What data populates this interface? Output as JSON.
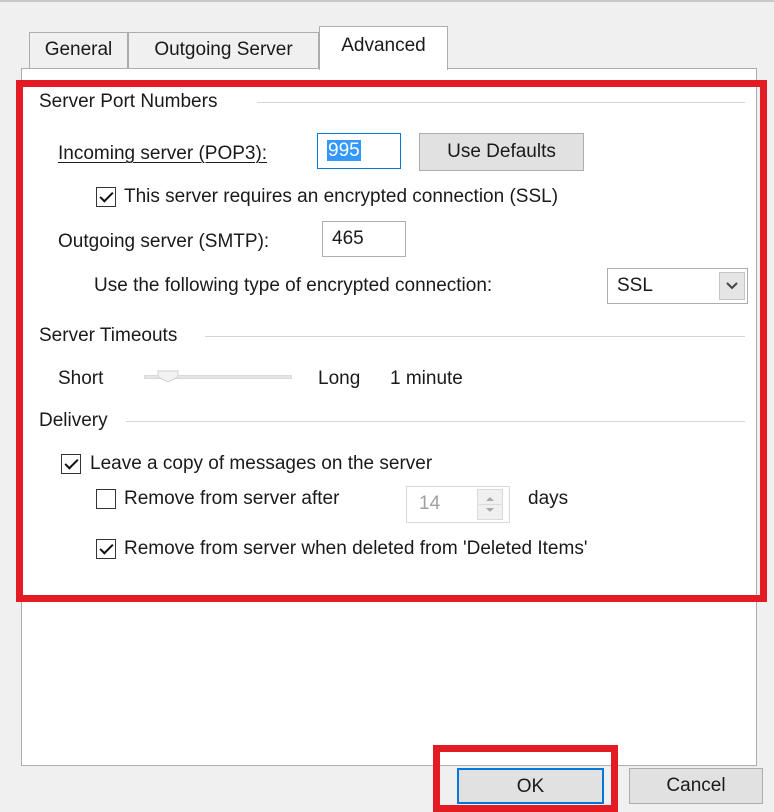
{
  "tabs": [
    {
      "label": "General"
    },
    {
      "label": "Outgoing Server"
    },
    {
      "label": "Advanced"
    }
  ],
  "ports": {
    "group_title": "Server Port Numbers",
    "incoming_label": "Incoming server (POP3):",
    "incoming_value": "995",
    "use_defaults_label": "Use Defaults",
    "ssl_required_label": "This server requires an encrypted connection (SSL)",
    "ssl_required_checked": true,
    "outgoing_label": "Outgoing server (SMTP):",
    "outgoing_value": "465",
    "encryption_label": "Use the following type of encrypted connection:",
    "encryption_value": "SSL"
  },
  "timeouts": {
    "group_title": "Server Timeouts",
    "short_label": "Short",
    "long_label": "Long",
    "value_label": "1 minute",
    "slider_level": 0.1
  },
  "delivery": {
    "group_title": "Delivery",
    "leave_copy_label": "Leave a copy of messages on the server",
    "leave_copy_checked": true,
    "remove_after_label": "Remove from server after",
    "remove_after_checked": false,
    "days_value": "14",
    "days_label": "days",
    "remove_deleted_label": "Remove from server when deleted from 'Deleted Items'",
    "remove_deleted_checked": true
  },
  "buttons": {
    "ok_label": "OK",
    "cancel_label": "Cancel"
  },
  "colors": {
    "highlight_red": "#e31c23",
    "selection_blue": "#3399ff",
    "ok_button_border": "#0078d7"
  }
}
